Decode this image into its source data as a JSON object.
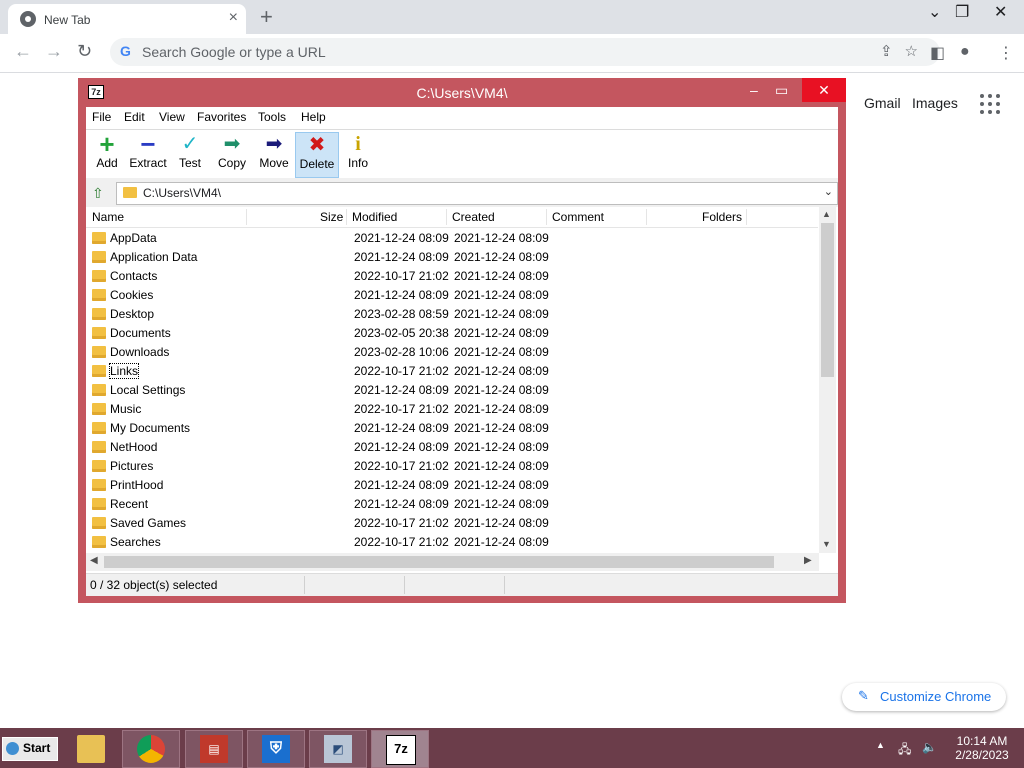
{
  "browser": {
    "tab_title": "New Tab",
    "omnibox_placeholder": "Search Google or type a URL",
    "links": [
      "Gmail",
      "Images"
    ],
    "customize_label": "Customize Chrome"
  },
  "app": {
    "window_title": "C:\\Users\\VM4\\",
    "logo": "7z",
    "menu": [
      "File",
      "Edit",
      "View",
      "Favorites",
      "Tools",
      "Help"
    ],
    "toolbar": [
      {
        "label": "Add",
        "icon": "add-icon"
      },
      {
        "label": "Extract",
        "icon": "extract-icon"
      },
      {
        "label": "Test",
        "icon": "test-icon"
      },
      {
        "label": "Copy",
        "icon": "copy-icon"
      },
      {
        "label": "Move",
        "icon": "move-icon"
      },
      {
        "label": "Delete",
        "icon": "delete-icon"
      },
      {
        "label": "Info",
        "icon": "info-icon"
      }
    ],
    "path": "C:\\Users\\VM4\\",
    "columns": [
      "Name",
      "Size",
      "Modified",
      "Created",
      "Comment",
      "Folders"
    ],
    "rows": [
      {
        "name": "AppData",
        "modified": "2021-12-24 08:09",
        "created": "2021-12-24 08:09"
      },
      {
        "name": "Application Data",
        "modified": "2021-12-24 08:09",
        "created": "2021-12-24 08:09"
      },
      {
        "name": "Contacts",
        "modified": "2022-10-17 21:02",
        "created": "2021-12-24 08:09"
      },
      {
        "name": "Cookies",
        "modified": "2021-12-24 08:09",
        "created": "2021-12-24 08:09"
      },
      {
        "name": "Desktop",
        "modified": "2023-02-28 08:59",
        "created": "2021-12-24 08:09"
      },
      {
        "name": "Documents",
        "modified": "2023-02-05 20:38",
        "created": "2021-12-24 08:09"
      },
      {
        "name": "Downloads",
        "modified": "2023-02-28 10:06",
        "created": "2021-12-24 08:09"
      },
      {
        "name": "Links",
        "modified": "2022-10-17 21:02",
        "created": "2021-12-24 08:09"
      },
      {
        "name": "Local Settings",
        "modified": "2021-12-24 08:09",
        "created": "2021-12-24 08:09"
      },
      {
        "name": "Music",
        "modified": "2022-10-17 21:02",
        "created": "2021-12-24 08:09"
      },
      {
        "name": "My Documents",
        "modified": "2021-12-24 08:09",
        "created": "2021-12-24 08:09"
      },
      {
        "name": "NetHood",
        "modified": "2021-12-24 08:09",
        "created": "2021-12-24 08:09"
      },
      {
        "name": "Pictures",
        "modified": "2022-10-17 21:02",
        "created": "2021-12-24 08:09"
      },
      {
        "name": "PrintHood",
        "modified": "2021-12-24 08:09",
        "created": "2021-12-24 08:09"
      },
      {
        "name": "Recent",
        "modified": "2021-12-24 08:09",
        "created": "2021-12-24 08:09"
      },
      {
        "name": "Saved Games",
        "modified": "2022-10-17 21:02",
        "created": "2021-12-24 08:09"
      },
      {
        "name": "Searches",
        "modified": "2022-10-17 21:02",
        "created": "2021-12-24 08:09"
      }
    ],
    "status": "0 / 32 object(s) selected"
  },
  "taskbar": {
    "start_label": "Start",
    "time": "10:14 AM",
    "date": "2/28/2023",
    "items": [
      "chrome-icon",
      "word-icon",
      "defender-icon",
      "system-icon",
      "7zip-icon"
    ]
  },
  "colors": {
    "window_frame": "#c4565f",
    "taskbar": "#6b3d4a",
    "accent": "#1a73e8"
  }
}
